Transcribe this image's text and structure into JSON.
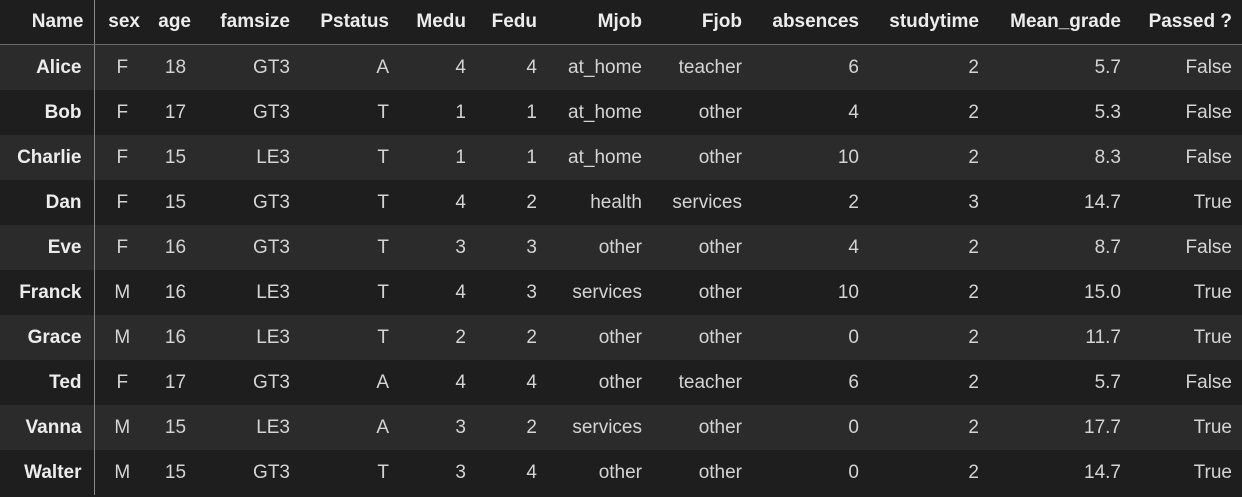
{
  "columns": [
    "Name",
    "sex",
    "age",
    "famsize",
    "Pstatus",
    "Medu",
    "Fedu",
    "Mjob",
    "Fjob",
    "absences",
    "studytime",
    "Mean_grade",
    "Passed ?"
  ],
  "rows": [
    {
      "name": "Alice",
      "cells": [
        "F",
        "18",
        "GT3",
        "A",
        "4",
        "4",
        "at_home",
        "teacher",
        "6",
        "2",
        "5.7",
        "False"
      ]
    },
    {
      "name": "Bob",
      "cells": [
        "F",
        "17",
        "GT3",
        "T",
        "1",
        "1",
        "at_home",
        "other",
        "4",
        "2",
        "5.3",
        "False"
      ]
    },
    {
      "name": "Charlie",
      "cells": [
        "F",
        "15",
        "LE3",
        "T",
        "1",
        "1",
        "at_home",
        "other",
        "10",
        "2",
        "8.3",
        "False"
      ]
    },
    {
      "name": "Dan",
      "cells": [
        "F",
        "15",
        "GT3",
        "T",
        "4",
        "2",
        "health",
        "services",
        "2",
        "3",
        "14.7",
        "True"
      ]
    },
    {
      "name": "Eve",
      "cells": [
        "F",
        "16",
        "GT3",
        "T",
        "3",
        "3",
        "other",
        "other",
        "4",
        "2",
        "8.7",
        "False"
      ]
    },
    {
      "name": "Franck",
      "cells": [
        "M",
        "16",
        "LE3",
        "T",
        "4",
        "3",
        "services",
        "other",
        "10",
        "2",
        "15.0",
        "True"
      ]
    },
    {
      "name": "Grace",
      "cells": [
        "M",
        "16",
        "LE3",
        "T",
        "2",
        "2",
        "other",
        "other",
        "0",
        "2",
        "11.7",
        "True"
      ]
    },
    {
      "name": "Ted",
      "cells": [
        "F",
        "17",
        "GT3",
        "A",
        "4",
        "4",
        "other",
        "teacher",
        "6",
        "2",
        "5.7",
        "False"
      ]
    },
    {
      "name": "Vanna",
      "cells": [
        "M",
        "15",
        "LE3",
        "A",
        "3",
        "2",
        "services",
        "other",
        "0",
        "2",
        "17.7",
        "True"
      ]
    },
    {
      "name": "Walter",
      "cells": [
        "M",
        "15",
        "GT3",
        "T",
        "3",
        "4",
        "other",
        "other",
        "0",
        "2",
        "14.7",
        "True"
      ]
    }
  ],
  "colors": {
    "background": "#1e1e1e",
    "row_stripe": "#2b2b2b",
    "text": "#d4d4d4",
    "header_text": "#ececec"
  }
}
